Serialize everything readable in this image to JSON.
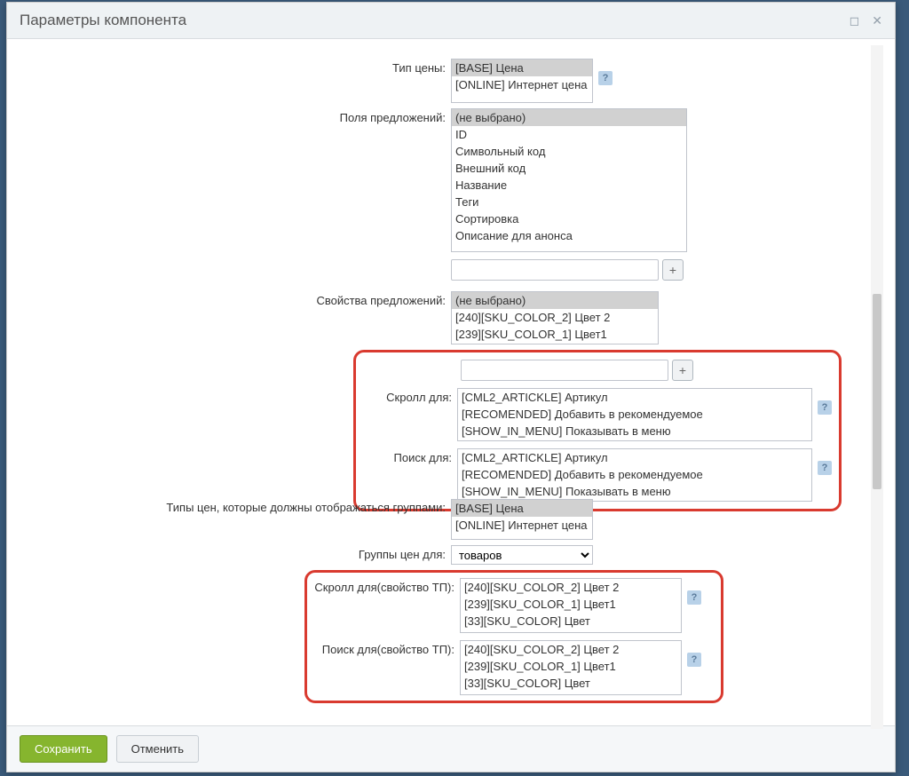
{
  "dialog": {
    "title": "Параметры компонента"
  },
  "labels": {
    "price_type": "Тип цены:",
    "offer_fields": "Поля предложений:",
    "offer_props": "Свойства предложений:",
    "scroll_for": "Скролл для:",
    "search_for": "Поиск для:",
    "price_groups_display": "Типы цен, которые должны отображаться группами:",
    "price_groups_for": "Группы цен для:",
    "scroll_for_tp": "Скролл для(свойство ТП):",
    "search_for_tp": "Поиск для(свойство ТП):"
  },
  "price_type_options": [
    {
      "label": "[BASE] Цена",
      "selected": true
    },
    {
      "label": "[ONLINE] Интернет цена",
      "selected": false
    }
  ],
  "offer_fields_options": [
    {
      "label": "(не выбрано)",
      "selected": true
    },
    {
      "label": "ID",
      "selected": false
    },
    {
      "label": "Символьный код",
      "selected": false
    },
    {
      "label": "Внешний код",
      "selected": false
    },
    {
      "label": "Название",
      "selected": false
    },
    {
      "label": "Теги",
      "selected": false
    },
    {
      "label": "Сортировка",
      "selected": false
    },
    {
      "label": "Описание для анонса",
      "selected": false
    }
  ],
  "offer_props_options": [
    {
      "label": "(не выбрано)",
      "selected": true
    },
    {
      "label": "[240][SKU_COLOR_2] Цвет 2",
      "selected": false
    },
    {
      "label": "[239][SKU_COLOR_1] Цвет1",
      "selected": false
    }
  ],
  "scroll_for_options": [
    {
      "label": "[CML2_ARTICKLE] Артикул",
      "selected": false
    },
    {
      "label": "[RECOMENDED] Добавить в рекомендуемое",
      "selected": false
    },
    {
      "label": "[SHOW_IN_MENU] Показывать в меню",
      "selected": false
    }
  ],
  "search_for_options": [
    {
      "label": "[CML2_ARTICKLE] Артикул",
      "selected": false
    },
    {
      "label": "[RECOMENDED] Добавить в рекомендуемое",
      "selected": false
    },
    {
      "label": "[SHOW_IN_MENU] Показывать в меню",
      "selected": false
    }
  ],
  "price_display_options": [
    {
      "label": "[BASE] Цена",
      "selected": true
    },
    {
      "label": "[ONLINE] Интернет цена",
      "selected": false
    }
  ],
  "price_groups_for_select": {
    "value": "товаров"
  },
  "scroll_tp_options": [
    {
      "label": "[240][SKU_COLOR_2] Цвет 2",
      "selected": false
    },
    {
      "label": "[239][SKU_COLOR_1] Цвет1",
      "selected": false
    },
    {
      "label": "[33][SKU_COLOR] Цвет",
      "selected": false
    }
  ],
  "search_tp_options": [
    {
      "label": "[240][SKU_COLOR_2] Цвет 2",
      "selected": false
    },
    {
      "label": "[239][SKU_COLOR_1] Цвет1",
      "selected": false
    },
    {
      "label": "[33][SKU_COLOR] Цвет",
      "selected": false
    }
  ],
  "buttons": {
    "save": "Сохранить",
    "cancel": "Отменить",
    "add": "+",
    "help": "?"
  }
}
